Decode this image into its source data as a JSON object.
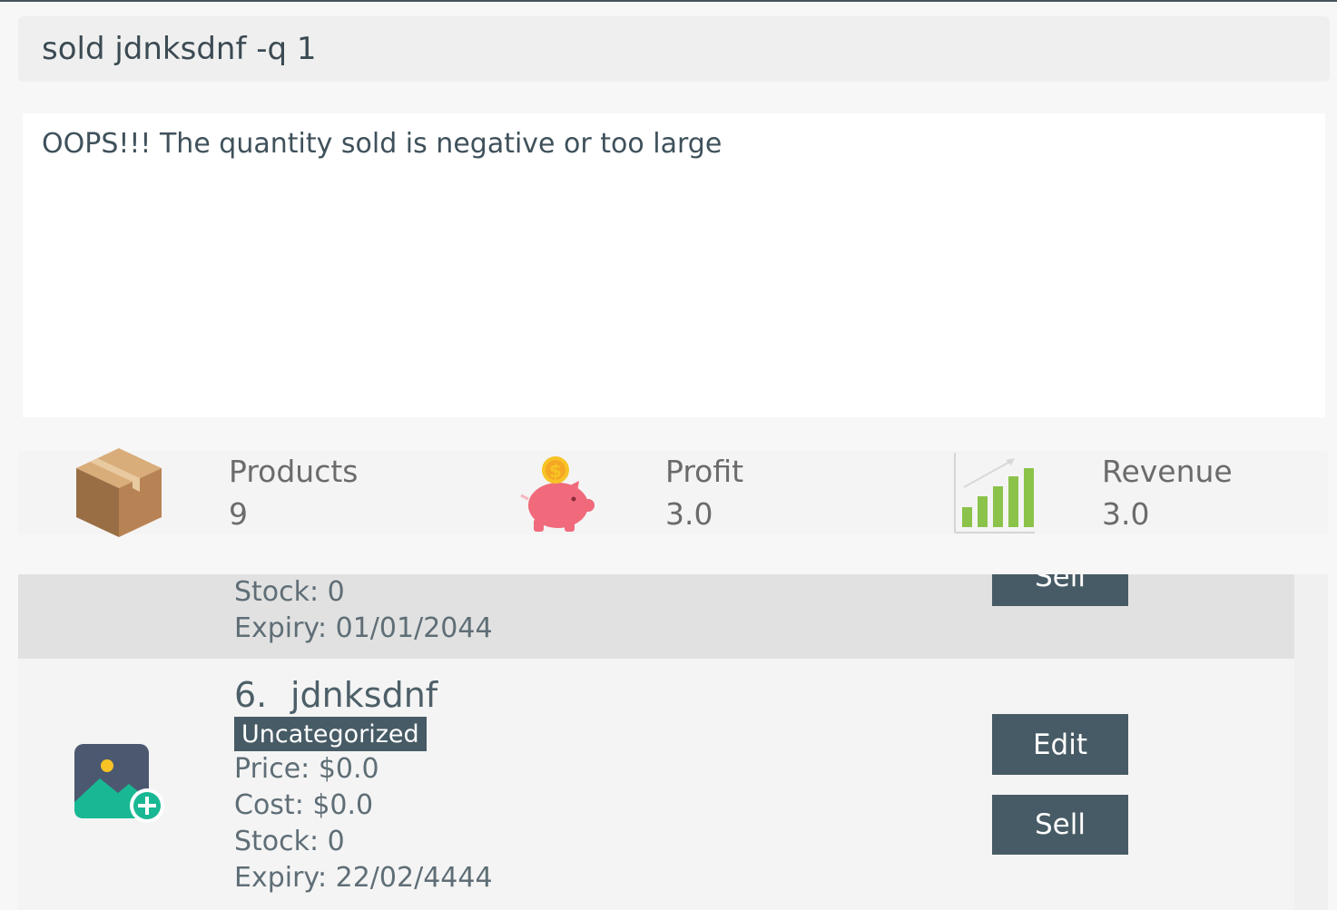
{
  "command": {
    "value": "sold jdnksdnf -q 1"
  },
  "output": {
    "message": "OOPS!!! The quantity sold is negative or too large"
  },
  "stats": {
    "products": {
      "label": "Products",
      "value": "9",
      "icon": "box-icon"
    },
    "profit": {
      "label": "Profit",
      "value": "3.0",
      "icon": "piggy-bank-icon"
    },
    "revenue": {
      "label": "Revenue",
      "value": "3.0",
      "icon": "bar-chart-icon"
    }
  },
  "products": {
    "partial": {
      "stock": "Stock: 0",
      "expiry": "Expiry: 01/01/2044",
      "sell_label": "Sell"
    },
    "item": {
      "index": "6.",
      "name": "jdnksdnf",
      "category": "Uncategorized",
      "price": "Price: $0.0",
      "cost": "Cost: $0.0",
      "stock": "Stock: 0",
      "expiry": "Expiry: 22/02/4444",
      "edit_label": "Edit",
      "sell_label": "Sell",
      "image_icon": "add-image-icon"
    }
  },
  "colors": {
    "button": "#475b66",
    "badge": "#475b66",
    "accent_green": "#8bc34a",
    "piggy": "#f06a7b"
  }
}
